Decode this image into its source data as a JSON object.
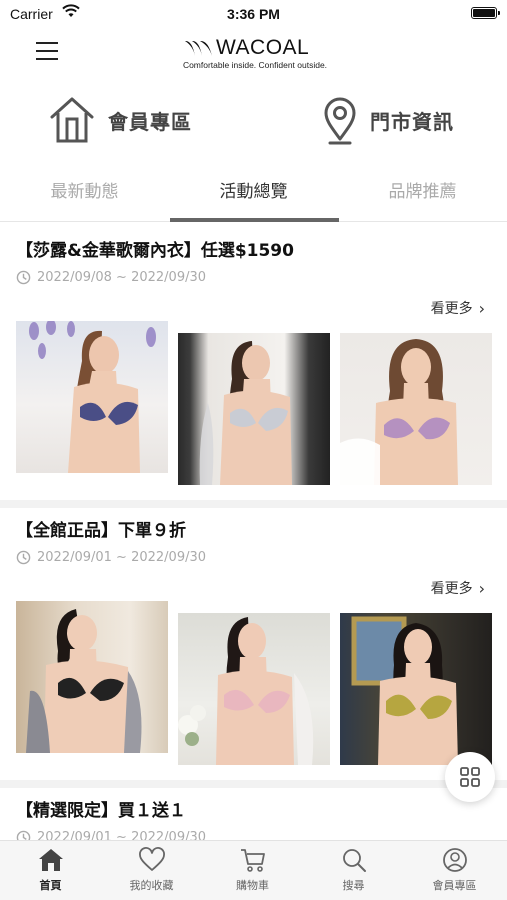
{
  "status_bar": {
    "carrier": "Carrier",
    "time": "3:36 PM"
  },
  "header": {
    "logo_text": "WACOAL",
    "tagline": "Comfortable inside. Confident outside."
  },
  "quick_links": [
    {
      "label": "會員專區",
      "icon": "home-icon"
    },
    {
      "label": "門市資訊",
      "icon": "location-pin-icon"
    }
  ],
  "tabs": [
    {
      "label": "最新動態",
      "active": false
    },
    {
      "label": "活動總覽",
      "active": true
    },
    {
      "label": "品牌推薦",
      "active": false
    }
  ],
  "promos": [
    {
      "title": "【莎露&金華歌爾內衣】任選$1590",
      "date": "2022/09/08 ~ 2022/09/30",
      "see_more": "看更多",
      "bra_colors": [
        "#4a4e86",
        "#c9ccd4",
        "#b591c0"
      ]
    },
    {
      "title": "【全館正品】下單９折",
      "date": "2022/09/01 ~ 2022/09/30",
      "see_more": "看更多",
      "bra_colors": [
        "#222222",
        "#e9b7bf",
        "#b6a640"
      ]
    },
    {
      "title": "【精選限定】買１送１",
      "date": "2022/09/01 ~ 2022/09/30"
    }
  ],
  "bottom_nav": [
    {
      "label": "首頁",
      "icon": "home-icon",
      "active": true
    },
    {
      "label": "我的收藏",
      "icon": "heart-icon",
      "active": false
    },
    {
      "label": "購物車",
      "icon": "cart-icon",
      "active": false
    },
    {
      "label": "搜尋",
      "icon": "search-icon",
      "active": false
    },
    {
      "label": "會員專區",
      "icon": "user-icon",
      "active": false
    }
  ],
  "colors": {
    "accent": "#666666",
    "inactive_tab": "#aaaaaa",
    "text": "#222222"
  }
}
